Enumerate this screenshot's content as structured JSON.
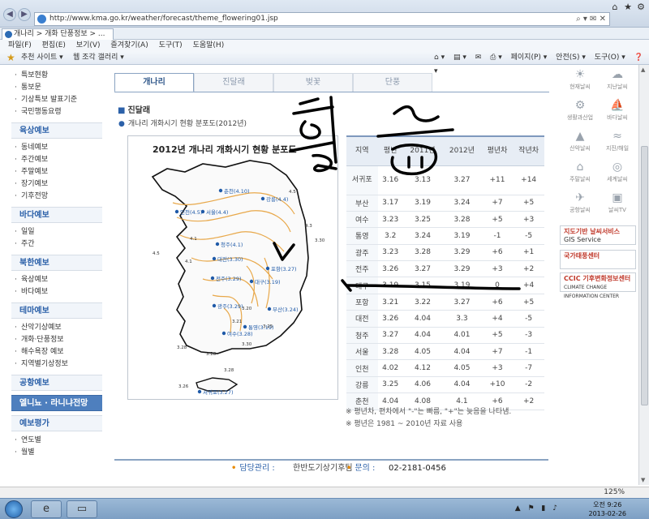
{
  "browser": {
    "url": "http://www.kma.go.kr/weather/forecast/theme_flowering01.jsp",
    "tab_label": "개나리 > 개화 단풍정보 > ...",
    "menu": [
      "파일(F)",
      "편집(E)",
      "보기(V)",
      "즐겨찾기(A)",
      "도구(T)",
      "도움말(H)"
    ],
    "fav_items": [
      "추천 사이트 ▾",
      "웹 조각 갤러리 ▾"
    ],
    "toolbar_right": [
      "페이지(P) ▾",
      "안전(S) ▾",
      "도구(O) ▾",
      "❓ ▾"
    ],
    "zoom": "125%"
  },
  "sidebar": {
    "groups": [
      {
        "head": null,
        "items": [
          "특보현황",
          "통보문",
          "기상특보 발표기준",
          "국민행동요령"
        ]
      },
      {
        "head": "육상예보",
        "items": [
          "동네예보",
          "주간예보",
          "주말예보",
          "장기예보",
          "기후전망"
        ]
      },
      {
        "head": "바다예보",
        "items": [
          "일일",
          "주간"
        ]
      },
      {
        "head": "북한예보",
        "items": [
          "육상예보",
          "바다예보"
        ]
      },
      {
        "head": "테마예보",
        "items": [
          "산악기상예보",
          "개화·단풍정보",
          "해수욕장 예보",
          "지역별기상정보"
        ]
      },
      {
        "head": "공항예보",
        "items": []
      },
      {
        "head": "엘니뇨 · 라니냐전망",
        "items": []
      },
      {
        "head": "예보평가",
        "items": [
          "연도별",
          "월별"
        ]
      }
    ]
  },
  "subtabs": [
    "개나리",
    "진달래",
    "벚꽃",
    "단풍"
  ],
  "section": {
    "title": "진달래",
    "subtitle": "개나리 개화시기 현황 분포도(2012년)"
  },
  "map": {
    "title": "2012년 개나리 개화시기 현황 분포도",
    "stations": [
      {
        "label": "춘천(4.10)"
      },
      {
        "label": "강릉(4.4)"
      },
      {
        "label": "인천(4.5)"
      },
      {
        "label": "서울(4.4)"
      },
      {
        "label": "청주(4.1)"
      },
      {
        "label": "대전(3.30)"
      },
      {
        "label": "포항(3.27)"
      },
      {
        "label": "대구(3.19)"
      },
      {
        "label": "전주(3.29)"
      },
      {
        "label": "광주(3.29)"
      },
      {
        "label": "부산(3.24)"
      },
      {
        "label": "통영(3.19)"
      },
      {
        "label": "여수(3.28)"
      },
      {
        "label": "서귀포(3.27)"
      }
    ],
    "isolines": [
      "4.5",
      "4.5",
      "4.3",
      "4.1",
      "4.1",
      "3.30",
      "3.28",
      "3.25",
      "3.20",
      "3.21",
      "3.28",
      "3.30",
      "3.26",
      "3.28"
    ]
  },
  "table": {
    "headers": [
      "지역",
      "평년",
      "2011년",
      "2012년",
      "평년차",
      "작년차"
    ],
    "rows": [
      [
        "서귀포",
        "3.16",
        "3.13",
        "3.27",
        "+11",
        "+14"
      ],
      [
        "부산",
        "3.17",
        "3.19",
        "3.24",
        "+7",
        "+5"
      ],
      [
        "여수",
        "3.23",
        "3.25",
        "3.28",
        "+5",
        "+3"
      ],
      [
        "통영",
        "3.2",
        "3.24",
        "3.19",
        "-1",
        "-5"
      ],
      [
        "광주",
        "3.23",
        "3.28",
        "3.29",
        "+6",
        "+1"
      ],
      [
        "전주",
        "3.26",
        "3.27",
        "3.29",
        "+3",
        "+2"
      ],
      [
        "대구",
        "3.19",
        "3.15",
        "3.19",
        "0",
        "+4"
      ],
      [
        "포항",
        "3.21",
        "3.22",
        "3.27",
        "+6",
        "+5"
      ],
      [
        "대전",
        "3.26",
        "4.04",
        "3.3",
        "+4",
        "-5"
      ],
      [
        "청주",
        "3.27",
        "4.04",
        "4.01",
        "+5",
        "-3"
      ],
      [
        "서울",
        "3.28",
        "4.05",
        "4.04",
        "+7",
        "-1"
      ],
      [
        "인천",
        "4.02",
        "4.12",
        "4.05",
        "+3",
        "-7"
      ],
      [
        "강릉",
        "3.25",
        "4.06",
        "4.04",
        "+10",
        "-2"
      ],
      [
        "춘천",
        "4.04",
        "4.08",
        "4.1",
        "+6",
        "+2"
      ]
    ],
    "notes": [
      "※ 평년차, 편차에서 \"-\"는 빠름, \"+\"는 늦음을 나타냄.",
      "※ 평년은 1981 ~ 2010년 자료 사용"
    ]
  },
  "right_icons": [
    {
      "name": "현재날씨",
      "glyph": "☀"
    },
    {
      "name": "지난날씨",
      "glyph": "☁"
    },
    {
      "name": "생활과산업",
      "glyph": "⚙"
    },
    {
      "name": "바다날씨",
      "glyph": "⛵"
    },
    {
      "name": "산악날씨",
      "glyph": "▲"
    },
    {
      "name": "지진/해일",
      "glyph": "≈"
    },
    {
      "name": "주말날씨",
      "glyph": "⌂"
    },
    {
      "name": "세계날씨",
      "glyph": "◎"
    },
    {
      "name": "공항날씨",
      "glyph": "✈"
    },
    {
      "name": "날씨TV",
      "glyph": "▣"
    }
  ],
  "banners": [
    {
      "line1": "지도기반 날씨서비스",
      "line2": "GIS Service"
    },
    {
      "line1": "국가태풍센터",
      "line2": ""
    },
    {
      "line1": "CCIC 기후변화정보센터",
      "line2": "CLIMATE CHANGE INFORMATION CENTER"
    }
  ],
  "footer": {
    "manager_label": "담당관리 :",
    "manager": "한반도기상기후팀",
    "contact_label": "문의 :",
    "phone": "02-2181-0456"
  },
  "taskbar": {
    "time": "오전 9:26",
    "date": "2013-02-26"
  },
  "handwriting": {
    "text": "월 술"
  }
}
